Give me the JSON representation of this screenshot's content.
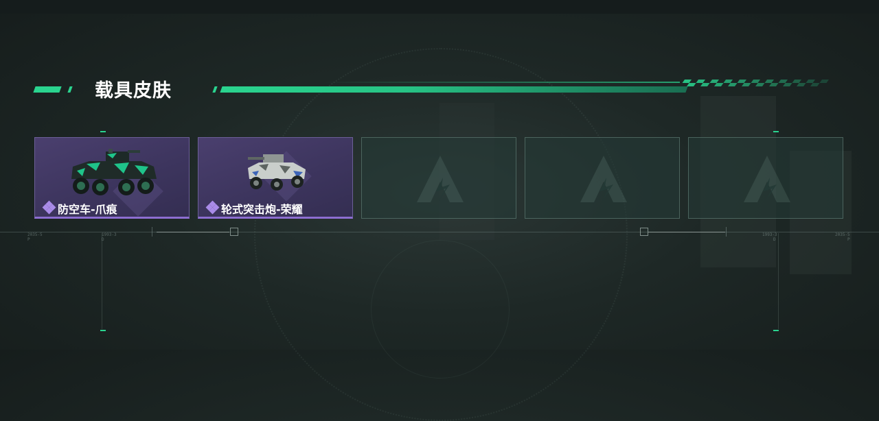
{
  "header": {
    "title": "载具皮肤"
  },
  "colors": {
    "accent": "#2ad48f",
    "rarity_purple": "#8d6ed1",
    "slot_empty_border": "#6e8c84"
  },
  "slots": [
    {
      "name": "防空车-爪痕",
      "state": "owned",
      "icon": "armored-vehicle-green-camo"
    },
    {
      "name": "轮式突击炮-荣耀",
      "state": "owned",
      "icon": "wheeled-assault-gun-white-camo"
    },
    {
      "name": "",
      "state": "empty",
      "icon": "placeholder-logo-icon"
    },
    {
      "name": "",
      "state": "empty",
      "icon": "placeholder-logo-icon"
    },
    {
      "name": "",
      "state": "empty",
      "icon": "placeholder-logo-icon"
    }
  ],
  "decor": {
    "tick_left_top": "2035-5",
    "tick_left_sub": "P",
    "tick_left2_top": "1993-3",
    "tick_left2_sub": "D",
    "tick_right2_top": "1993-3",
    "tick_right2_sub": "D",
    "tick_right_top": "2035-5",
    "tick_right_sub": "P"
  }
}
